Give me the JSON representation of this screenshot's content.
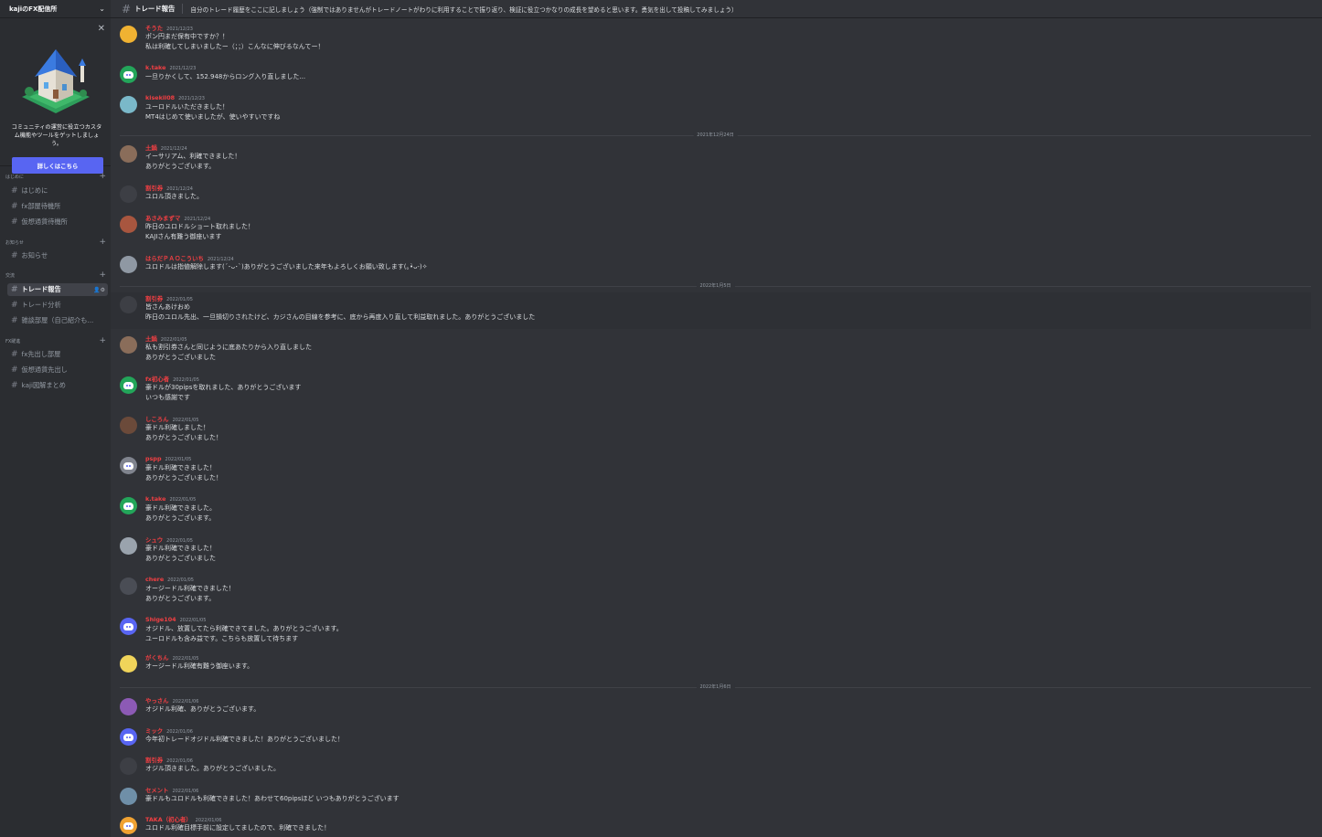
{
  "server": {
    "name": "kajiのFX配信所"
  },
  "promo": {
    "text": "コミュニティの運営に役立つカスタム機能やツールをゲットしましょう。",
    "button": "詳しくはこちら"
  },
  "sidebar": {
    "categories": [
      {
        "label": "はじめに",
        "channels": [
          "はじめに",
          "fx部屋待機所",
          "仮想通貨待機所"
        ]
      },
      {
        "label": "お知らせ",
        "channels": [
          "お知らせ"
        ]
      },
      {
        "label": "交流",
        "channels": [
          "トレード報告",
          "トレード分析",
          "雑談部屋（自己紹介も..."
        ]
      },
      {
        "label": "FX躍進",
        "channels": [
          "fx先出し部屋",
          "仮想通貨先出し",
          "kaji図解まとめ"
        ]
      }
    ]
  },
  "channel": {
    "name": "トレード報告",
    "topic": "自分のトレード履歴をここに記しましょう（強制ではありませんがトレードノートがわりに利用することで振り返り、検証に役立つかなりの成長を望めると思います。勇気を出して投稿してみましょう）"
  },
  "dividers": [
    "2021年12月24日",
    "2022年1月5日",
    "2022年1月6日"
  ],
  "messages": [
    {
      "user": "そうた",
      "time": "2021/12/23",
      "color": "#f23f43",
      "avatar": "#f0b232",
      "lines": [
        "ポン円まだ保有中ですか？！",
        "私は利確してしまいましたー（；；）こんなに伸びるなんてー！"
      ]
    },
    {
      "user": "k.take",
      "time": "2021/12/23",
      "color": "#f23f43",
      "avatar": "#23a55a",
      "lines": [
        "一旦りかくして、152.948からロング入り直しました..."
      ]
    },
    {
      "user": "kisekil08",
      "time": "2021/12/23",
      "color": "#f23f43",
      "avatar": "#7ab8c9",
      "lines": [
        "ユーロドルいただきました！",
        "MT4はじめて使いましたが、使いやすいですね"
      ]
    },
    {
      "user": "土鍋",
      "time": "2021/12/24",
      "color": "#f23f43",
      "avatar": "#8a6d5a",
      "lines": [
        "イーサリアム、利確できました！",
        "ありがとうございます。"
      ]
    },
    {
      "user": "割引券",
      "time": "2021/12/24",
      "color": "#f23f43",
      "avatar": "#3d3f45",
      "lines": [
        "ユロル頂きました。"
      ]
    },
    {
      "user": "あさみまずマ",
      "time": "2021/12/24",
      "color": "#f23f43",
      "avatar": "#a8563f",
      "lines": [
        "昨日のユロドルショート取れました！",
        "KAJIさん有難う御座います"
      ]
    },
    {
      "user": "はらだＰＡＯこういち",
      "time": "2021/12/24",
      "color": "#f23f43",
      "avatar": "#8f98a3",
      "lines": [
        "ユロドルは指値解除します(´･ᴗ･`)ありがとうございました来年もよろしくお願い致します(｡•̀ᴗ-)✧"
      ]
    },
    {
      "user": "割引券",
      "time": "2022/01/05",
      "color": "#f23f43",
      "avatar": "#3d3f45",
      "lines": [
        "皆さんあけおめ",
        "昨日のユロル先出、一旦損切りされたけど、カジさんの目線を参考に、底から再度入り直して利益取れました。ありがとうございました"
      ]
    },
    {
      "user": "土鍋",
      "time": "2022/01/05",
      "color": "#f23f43",
      "avatar": "#8a6d5a",
      "lines": [
        "私も割引券さんと同じように底あたりから入り直しました",
        "ありがとうございました"
      ]
    },
    {
      "user": "fx初心者",
      "time": "2022/01/05",
      "color": "#f23f43",
      "avatar": "#23a55a",
      "lines": [
        "豪ドルが30pipsを取れました、ありがとうございます",
        "いつも感謝です"
      ]
    },
    {
      "user": "しころん",
      "time": "2022/01/05",
      "color": "#f23f43",
      "avatar": "#6b4a3a",
      "lines": [
        "豪ドル利確しました！",
        "ありがとうございました！"
      ]
    },
    {
      "user": "pspp",
      "time": "2022/01/05",
      "color": "#f23f43",
      "avatar": "#80848e",
      "lines": [
        "豪ドル利確できました！",
        "ありがとうございました！"
      ]
    },
    {
      "user": "k.take",
      "time": "2022/01/05",
      "color": "#f23f43",
      "avatar": "#23a55a",
      "lines": [
        "豪ドル利確できました。",
        "ありがとうございます。"
      ]
    },
    {
      "user": "シュウ",
      "time": "2022/01/05",
      "color": "#f23f43",
      "avatar": "#9aa3ad",
      "lines": [
        "豪ドル利確できました！",
        "ありがとうございました"
      ]
    },
    {
      "user": "chere",
      "time": "2022/01/05",
      "color": "#f23f43",
      "avatar": "#4a4d55",
      "lines": [
        "オージードル利確できました！",
        "ありがとうございます。"
      ]
    },
    {
      "user": "Shige104",
      "time": "2022/01/05",
      "color": "#f23f43",
      "avatar": "#5865f2",
      "lines": [
        "オジドル、放置してたら利確できてました。ありがとうございます。",
        "ユーロドルも含み益です。こちらも放置して待ちます"
      ]
    },
    {
      "user": "がくちん",
      "time": "2022/01/05",
      "color": "#f23f43",
      "avatar": "#f0d45a",
      "lines": [
        "オージードル利確有難う御座います。"
      ]
    },
    {
      "user": "やっさん",
      "time": "2022/01/06",
      "color": "#f23f43",
      "avatar": "#8c5ab5",
      "lines": [
        "オジドル利確、ありがとうございます。"
      ]
    },
    {
      "user": "ミック",
      "time": "2022/01/06",
      "color": "#f23f43",
      "avatar": "#5865f2",
      "lines": [
        "今年初トレードオジドル利確できました！ありがとうございました！"
      ]
    },
    {
      "user": "割引券",
      "time": "2022/01/06",
      "color": "#f23f43",
      "avatar": "#3d3f45",
      "lines": [
        "オジル頂きました。ありがとうございました。"
      ]
    },
    {
      "user": "セメント",
      "time": "2022/01/06",
      "color": "#f23f43",
      "avatar": "#6f8fa8",
      "lines": [
        "豪ドルもユロドルも利確できました！あわせて60pipsほど いつもありがとうございます"
      ]
    },
    {
      "user": "TAKA（初心者）",
      "time": "2022/01/06",
      "color": "#f23f43",
      "avatar": "#f0a232",
      "lines": [
        "ユロドル利確目標手前に設定してましたので、利確できました！"
      ]
    }
  ]
}
